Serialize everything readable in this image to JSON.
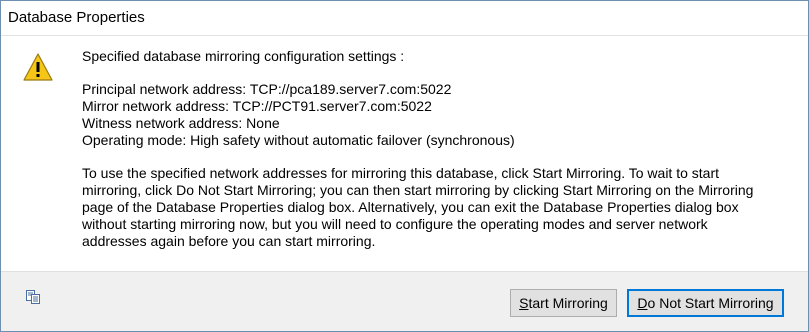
{
  "window": {
    "title": "Database Properties"
  },
  "message": {
    "heading": "Specified database mirroring configuration settings :",
    "settings": [
      "Principal network address: TCP://pca189.server7.com:5022",
      "Mirror network address: TCP://PCT91.server7.com:5022",
      "Witness network address: None",
      "Operating mode: High safety without automatic failover (synchronous)"
    ],
    "body_lines": [
      "To use the specified network addresses for mirroring this database, click Start Mirroring.  To wait to start",
      "mirroring, click Do Not Start Mirroring; you can then start mirroring by clicking Start Mirroring on the Mirroring",
      "page of the Database Properties dialog box. Alternatively, you can exit the Database Properties dialog box",
      "without starting mirroring now, but you will need to configure the operating modes and server network",
      "addresses again before you can start mirroring."
    ]
  },
  "icons": {
    "warning": "warning-icon",
    "copy": "copy-icon"
  },
  "buttons": {
    "start_mirroring": {
      "mnemonic": "S",
      "rest": "tart Mirroring"
    },
    "do_not_start": {
      "mnemonic": "D",
      "rest": "o Not Start Mirroring"
    }
  },
  "colors": {
    "focus_border": "#0078d7",
    "warning_fill": "#f5c518"
  }
}
